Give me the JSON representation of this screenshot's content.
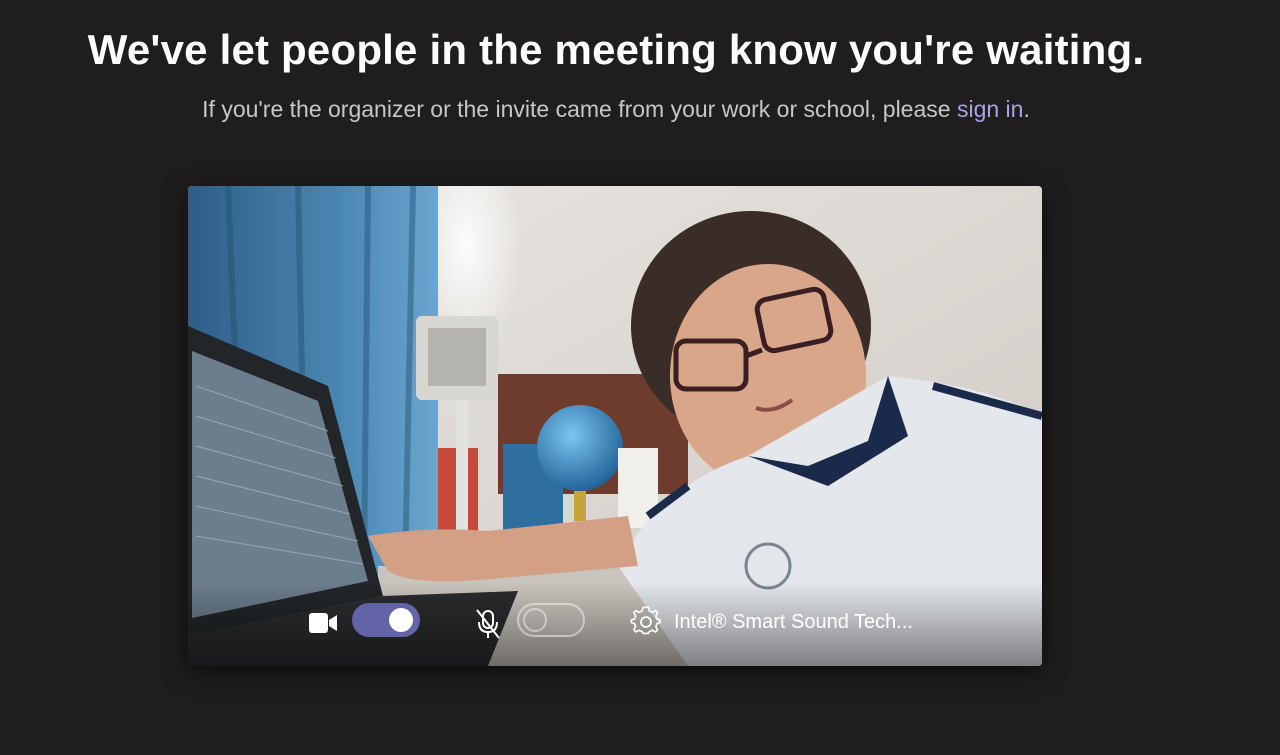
{
  "header": {
    "title": "We've let people in the meeting know you're waiting.",
    "subtitle_before": "If you're the organizer or the invite came from your work or school, please ",
    "sign_in_link": "sign in",
    "subtitle_after": "."
  },
  "preview": {
    "controls": {
      "camera_icon": "video-camera-icon",
      "camera_toggle_on": true,
      "mic_icon": "microphone-off-icon",
      "mic_toggle_on": false,
      "settings_icon": "gear-icon",
      "audio_device_label": "Intel® Smart Sound Tech..."
    }
  },
  "colors": {
    "background": "#1f1d1e",
    "accent": "#6264a7",
    "link": "#a9a4e6"
  }
}
